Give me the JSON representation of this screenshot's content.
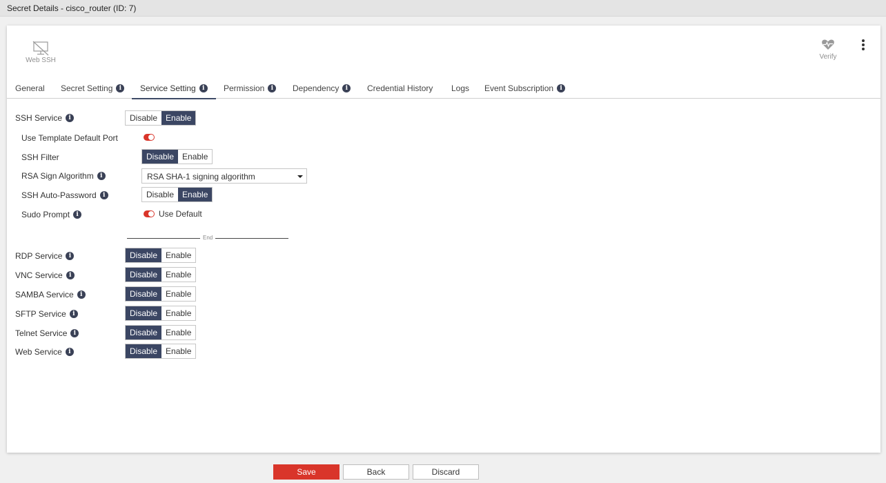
{
  "window": {
    "title": "Secret Details - cisco_router (ID: 7)"
  },
  "toolbar": {
    "web_ssh": {
      "label": "Web SSH",
      "icon": "web-ssh-icon"
    },
    "verify": {
      "label": "Verify",
      "icon": "heart-pulse-icon"
    },
    "more_icon": "kebab-menu-icon"
  },
  "tabs": [
    {
      "label": "General",
      "info": false
    },
    {
      "label": "Secret Setting",
      "info": true
    },
    {
      "label": "Service Setting",
      "info": true,
      "active": true
    },
    {
      "label": "Permission",
      "info": true
    },
    {
      "label": "Dependency",
      "info": true
    },
    {
      "label": "Credential History",
      "info": false
    },
    {
      "label": "Logs",
      "info": false
    },
    {
      "label": "Event Subscription",
      "info": true
    }
  ],
  "ssh": {
    "label": "SSH Service",
    "state": "Enable",
    "options": [
      "Disable",
      "Enable"
    ],
    "sub": {
      "template_port": {
        "label": "Use Template Default Port",
        "on": true
      },
      "ssh_filter": {
        "label": "SSH Filter",
        "state": "Disable"
      },
      "rsa": {
        "label": "RSA Sign Algorithm",
        "value": "RSA SHA-1 signing algorithm"
      },
      "auto_password": {
        "label": "SSH Auto-Password",
        "state": "Enable"
      },
      "sudo": {
        "label": "Sudo Prompt",
        "on": true,
        "toggle_label": "Use Default"
      }
    },
    "end_label": "End"
  },
  "services": [
    {
      "label": "RDP Service",
      "state": "Disable"
    },
    {
      "label": "VNC Service",
      "state": "Disable"
    },
    {
      "label": "SAMBA Service",
      "state": "Disable"
    },
    {
      "label": "SFTP Service",
      "state": "Disable"
    },
    {
      "label": "Telnet Service",
      "state": "Disable"
    },
    {
      "label": "Web Service",
      "state": "Disable"
    }
  ],
  "footer": {
    "save": "Save",
    "back": "Back",
    "discard": "Discard"
  },
  "colors": {
    "accent": "#d9352a",
    "selected": "#3b4663",
    "info_icon": "#3a4156"
  }
}
